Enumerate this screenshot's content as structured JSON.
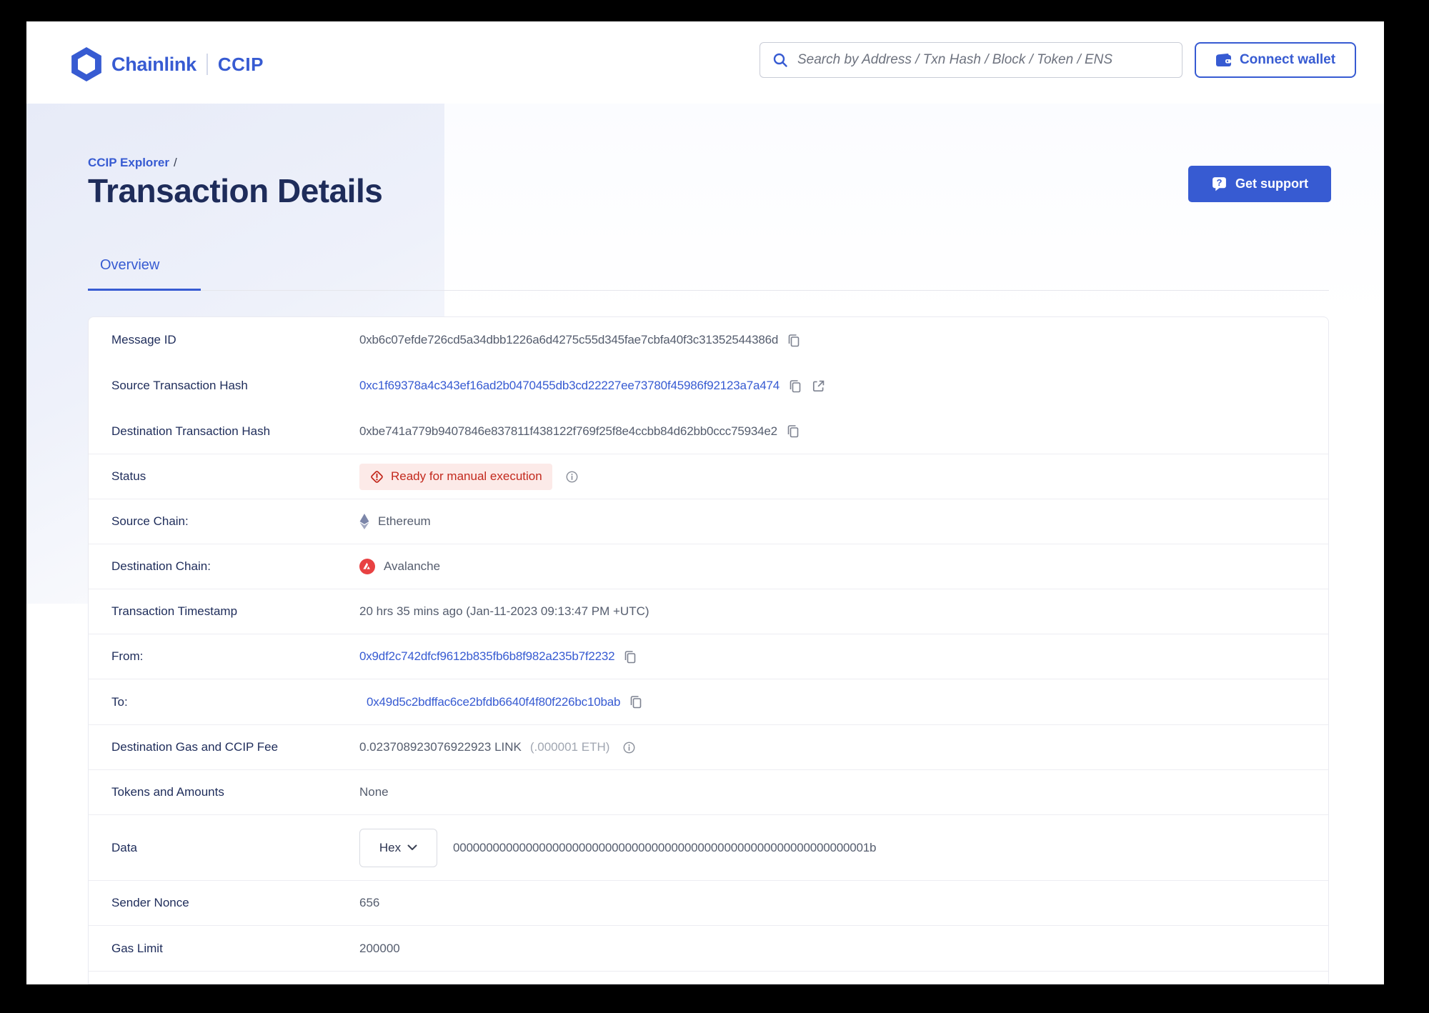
{
  "header": {
    "brand_name": "Chainlink",
    "brand_product": "CCIP",
    "search_placeholder": "Search by Address / Txn Hash / Block / Token / ENS",
    "connect_wallet_label": "Connect wallet"
  },
  "hero": {
    "breadcrumb": "CCIP Explorer",
    "breadcrumb_separator": "/",
    "title": "Transaction Details",
    "get_support_label": "Get support"
  },
  "tabs": [
    {
      "label": "Overview",
      "active": true
    }
  ],
  "details": {
    "rows": [
      {
        "label": "Message ID",
        "value": "0xb6c07efde726cd5a34dbb1226a6d4275c55d345fae7cbfa40f3c31352544386d"
      },
      {
        "label": "Source Transaction Hash",
        "value": "0xc1f69378a4c343ef16ad2b0470455db3cd22227ee73780f45986f92123a7a474"
      },
      {
        "label": "Destination Transaction Hash",
        "value": "0xbe741a779b9407846e837811f438122f769f25f8e4ccbb84d62bb0ccc75934e2"
      },
      {
        "label": "Status",
        "value": "Ready for manual execution"
      },
      {
        "label": "Source Chain:",
        "value": "Ethereum"
      },
      {
        "label": "Destination Chain:",
        "value": "Avalanche"
      },
      {
        "label": "Transaction Timestamp",
        "value": "20 hrs 35 mins ago (Jan-11-2023 09:13:47 PM +UTC)"
      },
      {
        "label": "From:",
        "value": "0x9df2c742dfcf9612b835fb6b8f982a235b7f2232"
      },
      {
        "label": "To:",
        "value": "0x49d5c2bdffac6ce2bfdb6640f4f80f226bc10bab"
      },
      {
        "label": "Destination Gas and CCIP Fee",
        "value": "0.023708923076922923 LINK",
        "value_secondary": "(.000001 ETH)"
      },
      {
        "label": "Tokens and Amounts",
        "value": "None"
      },
      {
        "label": "Data",
        "format": "Hex",
        "value": "000000000000000000000000000000000000000000000000000000000000001b"
      },
      {
        "label": "Sender Nonce",
        "value": "656"
      },
      {
        "label": "Gas Limit",
        "value": "200000"
      }
    ]
  },
  "icons": {
    "logo": "chainlink-hexagon",
    "search": "magnifier",
    "wallet": "wallet",
    "support": "question-chat-bubble",
    "copy": "copy-pages",
    "external": "arrow-out-of-box",
    "info": "circle-i",
    "status_warning": "diamond-exclamation",
    "source_chain": "ethereum-diamond",
    "destination_chain": "avalanche-circle",
    "dropdown": "chevron-down"
  },
  "colors": {
    "accent_blue": "#375BD2",
    "title_navy": "#1e2c5a",
    "value_gray": "#555d6e",
    "muted_gray": "#a0a6b1",
    "status_red": "#c32a1e",
    "status_badge_bg": "#fceae8",
    "avalanche_red": "#e84142",
    "ethereum_slate": "#6e79a0",
    "divider": "#ededf2"
  }
}
